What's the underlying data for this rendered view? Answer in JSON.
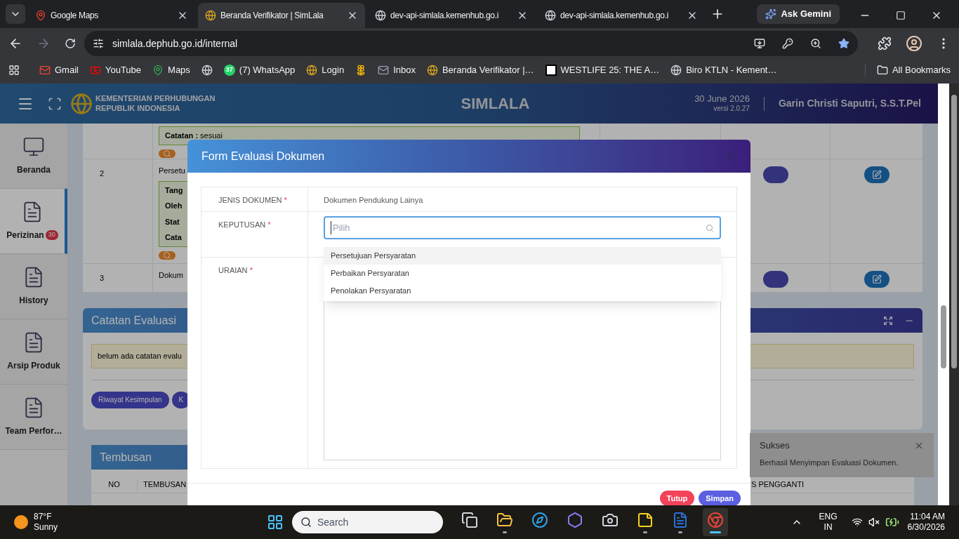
{
  "browser": {
    "tabs": [
      {
        "title": "Google Maps",
        "kind": "maps",
        "selected": false
      },
      {
        "title": "Beranda Verifikator | SimLala",
        "kind": "site",
        "selected": true
      },
      {
        "title": "dev-api-simlala.kemenhub.go.i",
        "kind": "globe",
        "selected": false
      },
      {
        "title": "dev-api-simlala.kemenhub.go.i",
        "kind": "globe",
        "selected": false
      }
    ],
    "gemini": "Ask Gemini",
    "url": "simlala.dephub.go.id/internal",
    "bookmarks": [
      {
        "kind": "gmail",
        "label": "Gmail"
      },
      {
        "kind": "youtube",
        "label": "YouTube"
      },
      {
        "kind": "maps",
        "label": "Maps"
      },
      {
        "kind": "globe"
      },
      {
        "kind": "whatsapp",
        "count": "37",
        "label": "(7) WhatsApp"
      },
      {
        "kind": "site",
        "label": "Login"
      },
      {
        "kind": "pinwheel"
      },
      {
        "kind": "mail",
        "label": "Inbox"
      },
      {
        "kind": "site",
        "label": "Beranda Verifikator |…"
      },
      {
        "kind": "westlife",
        "label": "WESTLIFE 25: THE A…"
      },
      {
        "kind": "globe",
        "label": "Biro KTLN - Kement…"
      }
    ],
    "all_bookmarks": "All Bookmarks"
  },
  "header": {
    "org": [
      "KEMENTERIAN PERHUBUNGAN",
      "REPUBLIK INDONESIA"
    ],
    "title": "SIMLALA",
    "date": "30 June 2026",
    "version": "versi 2.0.27",
    "user": "Garin Christi Saputri, S.S.T.Pel"
  },
  "sidebar": {
    "items": [
      {
        "label": "Beranda",
        "kind": "monitor",
        "selected": false
      },
      {
        "label": "Perizinan",
        "kind": "doc",
        "badge": "30",
        "selected": true
      },
      {
        "label": "History",
        "kind": "doc",
        "selected": false
      },
      {
        "label": "Arsip Produk",
        "kind": "doc",
        "selected": false
      },
      {
        "label": "Team Perfor…",
        "kind": "doc",
        "selected": false
      }
    ]
  },
  "table": {
    "rows": [
      {
        "lines": [
          "**Catatan :** sesuai"
        ],
        "actions": false
      },
      {
        "no": "2",
        "title": "Persetu",
        "lines": [
          "Tang",
          "Oleh",
          "Stat",
          "Cata"
        ],
        "actions": true
      },
      {
        "no": "3",
        "title": "Dokum",
        "actions": true
      }
    ]
  },
  "catatan": {
    "title": "Catatan Evaluasi",
    "alert": "belum ada catatan evalu",
    "buttons": [
      "Riwayat Kesimpulan",
      "K"
    ]
  },
  "tembusan": {
    "title": "Tembusan",
    "columns": [
      "NO",
      "TEMBUSAN",
      "S PENGGANTI"
    ]
  },
  "modal": {
    "title": "Form Evaluasi Dokumen",
    "fields": [
      {
        "label": "JENIS DOKUMEN",
        "mark": "*",
        "kind": "text",
        "value": "Dokumen Pendukung Lainya"
      },
      {
        "label": "KEPUTUSAN",
        "mark": "*",
        "kind": "select",
        "placeholder": "Pilih",
        "options": [
          {
            "label": "Persetujuan Persyaratan",
            "highlighted": true
          },
          {
            "label": "Perbaikan Persyaratan",
            "highlighted": false
          },
          {
            "label": "Penolakan Persyaratan",
            "highlighted": false
          }
        ]
      },
      {
        "label": "URAIAN",
        "mark": "*",
        "kind": "textarea"
      }
    ],
    "buttons": [
      {
        "label": "Tutup",
        "kind": "cancel"
      },
      {
        "label": "Simpan",
        "kind": "primary"
      }
    ]
  },
  "toast": {
    "title": "Sukses",
    "message": "Berhasil Menyimpan Evaluasi Dokumen."
  },
  "taskbar": {
    "weather": {
      "temp": "87°F",
      "desc": "Sunny"
    },
    "search": "Search",
    "apps": [
      {
        "kind": "taskview",
        "running": false,
        "selected": false
      },
      {
        "kind": "explorer",
        "running": true,
        "selected": false
      },
      {
        "kind": "edge",
        "running": false,
        "selected": false
      },
      {
        "kind": "copilot",
        "running": false,
        "selected": false
      },
      {
        "kind": "camera",
        "running": false,
        "selected": false
      },
      {
        "kind": "notes",
        "running": true,
        "selected": false
      },
      {
        "kind": "word",
        "running": true,
        "selected": false
      },
      {
        "kind": "chrome",
        "running": true,
        "selected": true
      }
    ],
    "lang": [
      "ENG",
      "IN"
    ],
    "time": "11:04 AM",
    "date": "6/30/2026"
  }
}
